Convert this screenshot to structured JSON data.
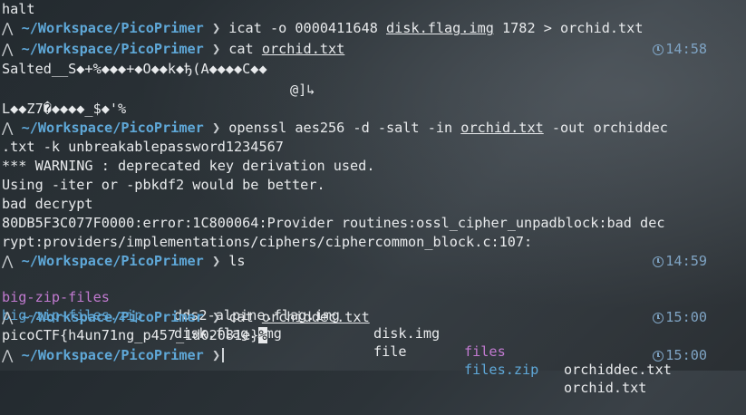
{
  "prompt": {
    "symbol": "⋀",
    "path": "~/Workspace/PicoPrimer",
    "chevron": "❯"
  },
  "lines": {
    "l0": "halt",
    "cmd1": "icat -o 0000411648 ",
    "cmd1_u": "disk.flag.img",
    "cmd1_rest": " 1782 > orchid.txt",
    "cmd2": "cat ",
    "cmd2_u": "orchid.txt",
    "time2": "14:58",
    "salted1": "Salted__S◆+%◆◆◆+◆O◆◆k◆ђ(A◆◆◆◆C◆◆",
    "salted2": "@]↳",
    "salted3": "L◆◆Z7�◆◆◆◆_$◆'%",
    "salted3_end": "%",
    "cmd3": "openssl aes256 -d -salt -in ",
    "cmd3_u": "orchid.txt",
    "cmd3_rest": " -out orchiddec",
    "cmd3_wrap": ".txt -k unbreakablepassword1234567",
    "warn1": "*** WARNING : deprecated key derivation used.",
    "warn2": "Using -iter or -pbkdf2 would be better.",
    "warn3": "bad decrypt",
    "err1": "80DB5F3C077F0000:error:1C800064:Provider routines:ossl_cipher_unpadblock:bad dec",
    "err2": "rypt:providers/implementations/ciphers/ciphercommon_block.c:107:",
    "cmd4": "ls",
    "time4": "14:59",
    "ls": {
      "r1": [
        "big-zip-files",
        "dds2-alpine.flag.img",
        "disk.img",
        "files",
        "orchiddec.txt"
      ],
      "r2": [
        "big-zip-files.zip",
        "disk.flag.img",
        "file",
        "files.zip",
        "orchid.txt"
      ]
    },
    "cmd5": "cat ",
    "cmd5_u": "orchiddec.txt",
    "time5": "15:00",
    "flag": "picoCTF{h4un71ng_p457_1d02081e}",
    "flag_end": "%",
    "time6": "15:00"
  }
}
